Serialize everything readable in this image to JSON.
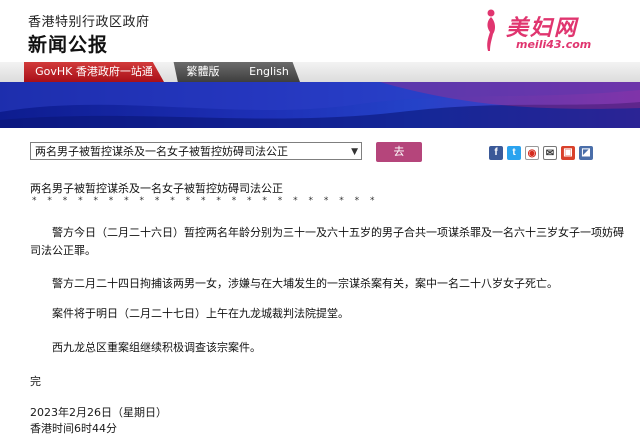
{
  "header": {
    "gov_name": "香港特别行政区政府",
    "press_title": "新闻公报"
  },
  "watermark": {
    "brand": "美妇网",
    "url": "meili43.com"
  },
  "nav": {
    "govhk": "GovHK 香港政府一站通",
    "traditional": "繁體版",
    "english": "English"
  },
  "toolbar": {
    "select_value": "两名男子被暂控谋杀及一名女子被暂控妨碍司法公正",
    "go_label": "去",
    "share_icons": [
      "facebook-icon",
      "twitter-icon",
      "weibo-icon",
      "email-icon",
      "print-icon",
      "rss-icon"
    ]
  },
  "article": {
    "headline": "两名男子被暂控谋杀及一名女子被暂控妨碍司法公正",
    "stars": "* * * * * * * * * * * * * * * * * * * * * * *",
    "p1": "警方今日（二月二十六日）暂控两名年龄分别为三十一及六十五岁的男子合共一项谋杀罪及一名六十三岁女子一项妨碍司法公正罪。",
    "p2": "警方二月二十四日拘捕该两男一女，涉嫌与在大埔发生的一宗谋杀案有关，案中一名二十八岁女子死亡。",
    "p3": "案件将于明日（二月二十七日）上午在九龙城裁判法院提堂。",
    "p4": "西九龙总区重案组继续积极调查该宗案件。",
    "end_mark": "完",
    "date": "2023年2月26日（星期日）",
    "time": "香港时间6时44分"
  },
  "colors": {
    "govhk_red": "#b8141f",
    "banner_blue": "#1d2fb5",
    "go_button": "#b5457b",
    "watermark_pink": "#e0356f"
  }
}
